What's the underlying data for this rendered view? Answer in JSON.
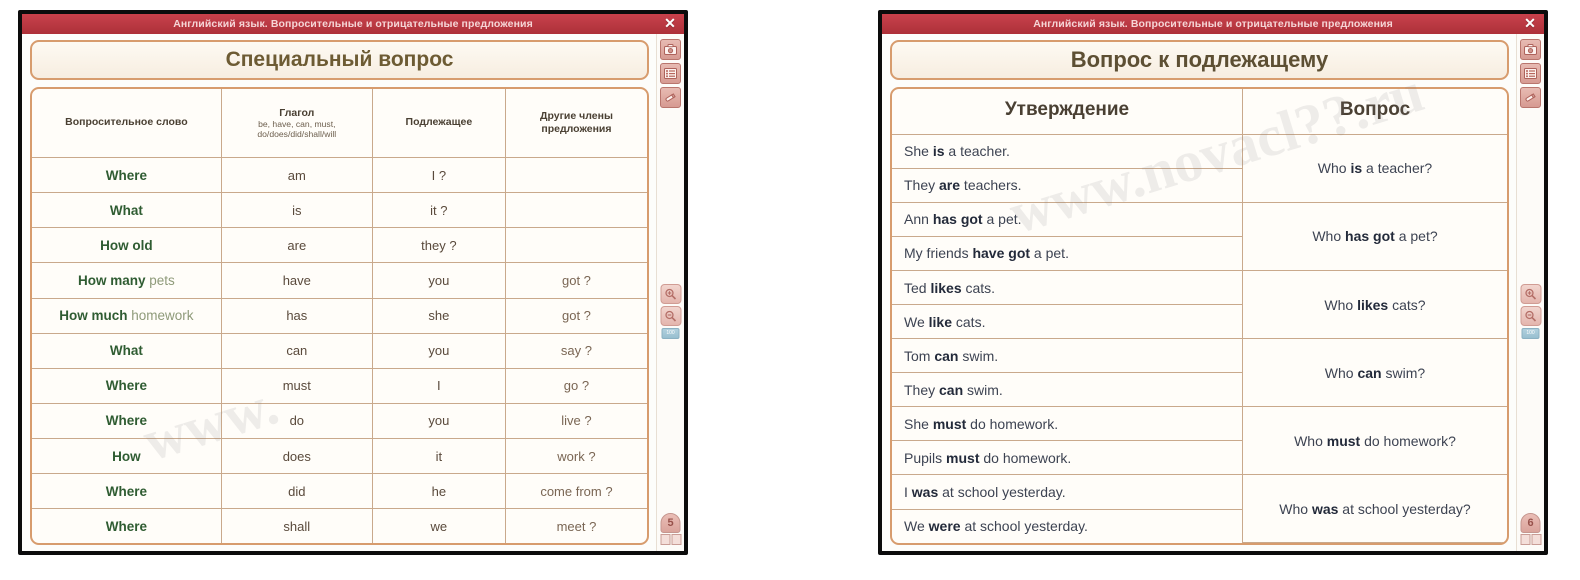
{
  "windows": [
    {
      "titlebar": "Английский язык. Вопросительные и отрицательные предложения",
      "close_label": "✕",
      "heading": "Специальный вопрос",
      "page": "5",
      "watermark": "www.",
      "toolbar": {
        "camera_label": "camera-icon",
        "list_label": "list-icon",
        "pencil_label": "pencil-icon",
        "zoom_in_label": "+",
        "zoom_out_label": "−",
        "slider_label": "100"
      },
      "table": {
        "headers": [
          {
            "main": "Вопросительное слово",
            "sub": ""
          },
          {
            "main": "Глагол",
            "sub": "be, have, can, must, do/does/did/shall/will"
          },
          {
            "main": "Подлежащее",
            "sub": ""
          },
          {
            "main": "Другие члены предложения",
            "sub": ""
          }
        ],
        "rows": [
          {
            "qword": "Where",
            "tail": "",
            "verb": "am",
            "subject": "I ?",
            "other": ""
          },
          {
            "qword": "What",
            "tail": "",
            "verb": "is",
            "subject": "it ?",
            "other": ""
          },
          {
            "qword": "How old",
            "tail": "",
            "verb": "are",
            "subject": "they ?",
            "other": ""
          },
          {
            "qword": "How many",
            "tail": "pets",
            "verb": "have",
            "subject": "you",
            "other": "got ?"
          },
          {
            "qword": "How much",
            "tail": "homework",
            "verb": "has",
            "subject": "she",
            "other": "got ?"
          },
          {
            "qword": "What",
            "tail": "",
            "verb": "can",
            "subject": "you",
            "other": "say ?"
          },
          {
            "qword": "Where",
            "tail": "",
            "verb": "must",
            "subject": "I",
            "other": "go ?"
          },
          {
            "qword": "Where",
            "tail": "",
            "verb": "do",
            "subject": "you",
            "other": "live ?"
          },
          {
            "qword": "How",
            "tail": "",
            "verb": "does",
            "subject": "it",
            "other": "work ?"
          },
          {
            "qword": "Where",
            "tail": "",
            "verb": "did",
            "subject": "he",
            "other": "come from ?"
          },
          {
            "qword": "Where",
            "tail": "",
            "verb": "shall",
            "subject": "we",
            "other": "meet ?"
          }
        ]
      }
    },
    {
      "titlebar": "Английский язык. Вопросительные и отрицательные предложения",
      "close_label": "✕",
      "heading": "Вопрос к подлежащему",
      "page": "6",
      "watermark": "www.novacl??.ru",
      "toolbar": {
        "camera_label": "camera-icon",
        "list_label": "list-icon",
        "pencil_label": "pencil-icon",
        "zoom_in_label": "+",
        "zoom_out_label": "−",
        "slider_label": "100"
      },
      "table": {
        "headers": [
          "Утверждение",
          "Вопрос"
        ],
        "groups": [
          {
            "statements": [
              {
                "pre": "She ",
                "bold": "is",
                "post": " a teacher."
              },
              {
                "pre": "They ",
                "bold": "are",
                "post": " teachers."
              }
            ],
            "question": {
              "pre": "Who ",
              "bold": "is",
              "post": " a teacher?"
            }
          },
          {
            "statements": [
              {
                "pre": "Ann ",
                "bold": "has got",
                "post": " a pet."
              },
              {
                "pre": "My friends ",
                "bold": "have got",
                "post": " a pet."
              }
            ],
            "question": {
              "pre": "Who ",
              "bold": "has got",
              "post": " a pet?"
            }
          },
          {
            "statements": [
              {
                "pre": "Ted ",
                "bold": "likes",
                "post": " cats."
              },
              {
                "pre": "We ",
                "bold": "like",
                "post": " cats."
              }
            ],
            "question": {
              "pre": "Who ",
              "bold": "likes",
              "post": " cats?"
            }
          },
          {
            "statements": [
              {
                "pre": "Tom ",
                "bold": "can",
                "post": " swim."
              },
              {
                "pre": "They ",
                "bold": "can",
                "post": " swim."
              }
            ],
            "question": {
              "pre": "Who ",
              "bold": "can",
              "post": " swim?"
            }
          },
          {
            "statements": [
              {
                "pre": "She ",
                "bold": "must",
                "post": " do homework."
              },
              {
                "pre": "Pupils ",
                "bold": "must",
                "post": " do homework."
              }
            ],
            "question": {
              "pre": "Who ",
              "bold": "must",
              "post": " do homework?"
            }
          },
          {
            "statements": [
              {
                "pre": "I ",
                "bold": "was",
                "post": " at school yesterday."
              },
              {
                "pre": "We ",
                "bold": "were",
                "post": " at school yesterday."
              }
            ],
            "question": {
              "pre": "Who ",
              "bold": "was",
              "post": " at school yesterday?"
            }
          }
        ]
      }
    }
  ],
  "colors": {
    "titlebar": "#bc3a44",
    "frame_border": "#d79c6e",
    "heading_text": "#6d5b33",
    "question_word": "#2f5c32",
    "cell_text": "#5a4a3c",
    "statement_text": "#3d4352"
  }
}
